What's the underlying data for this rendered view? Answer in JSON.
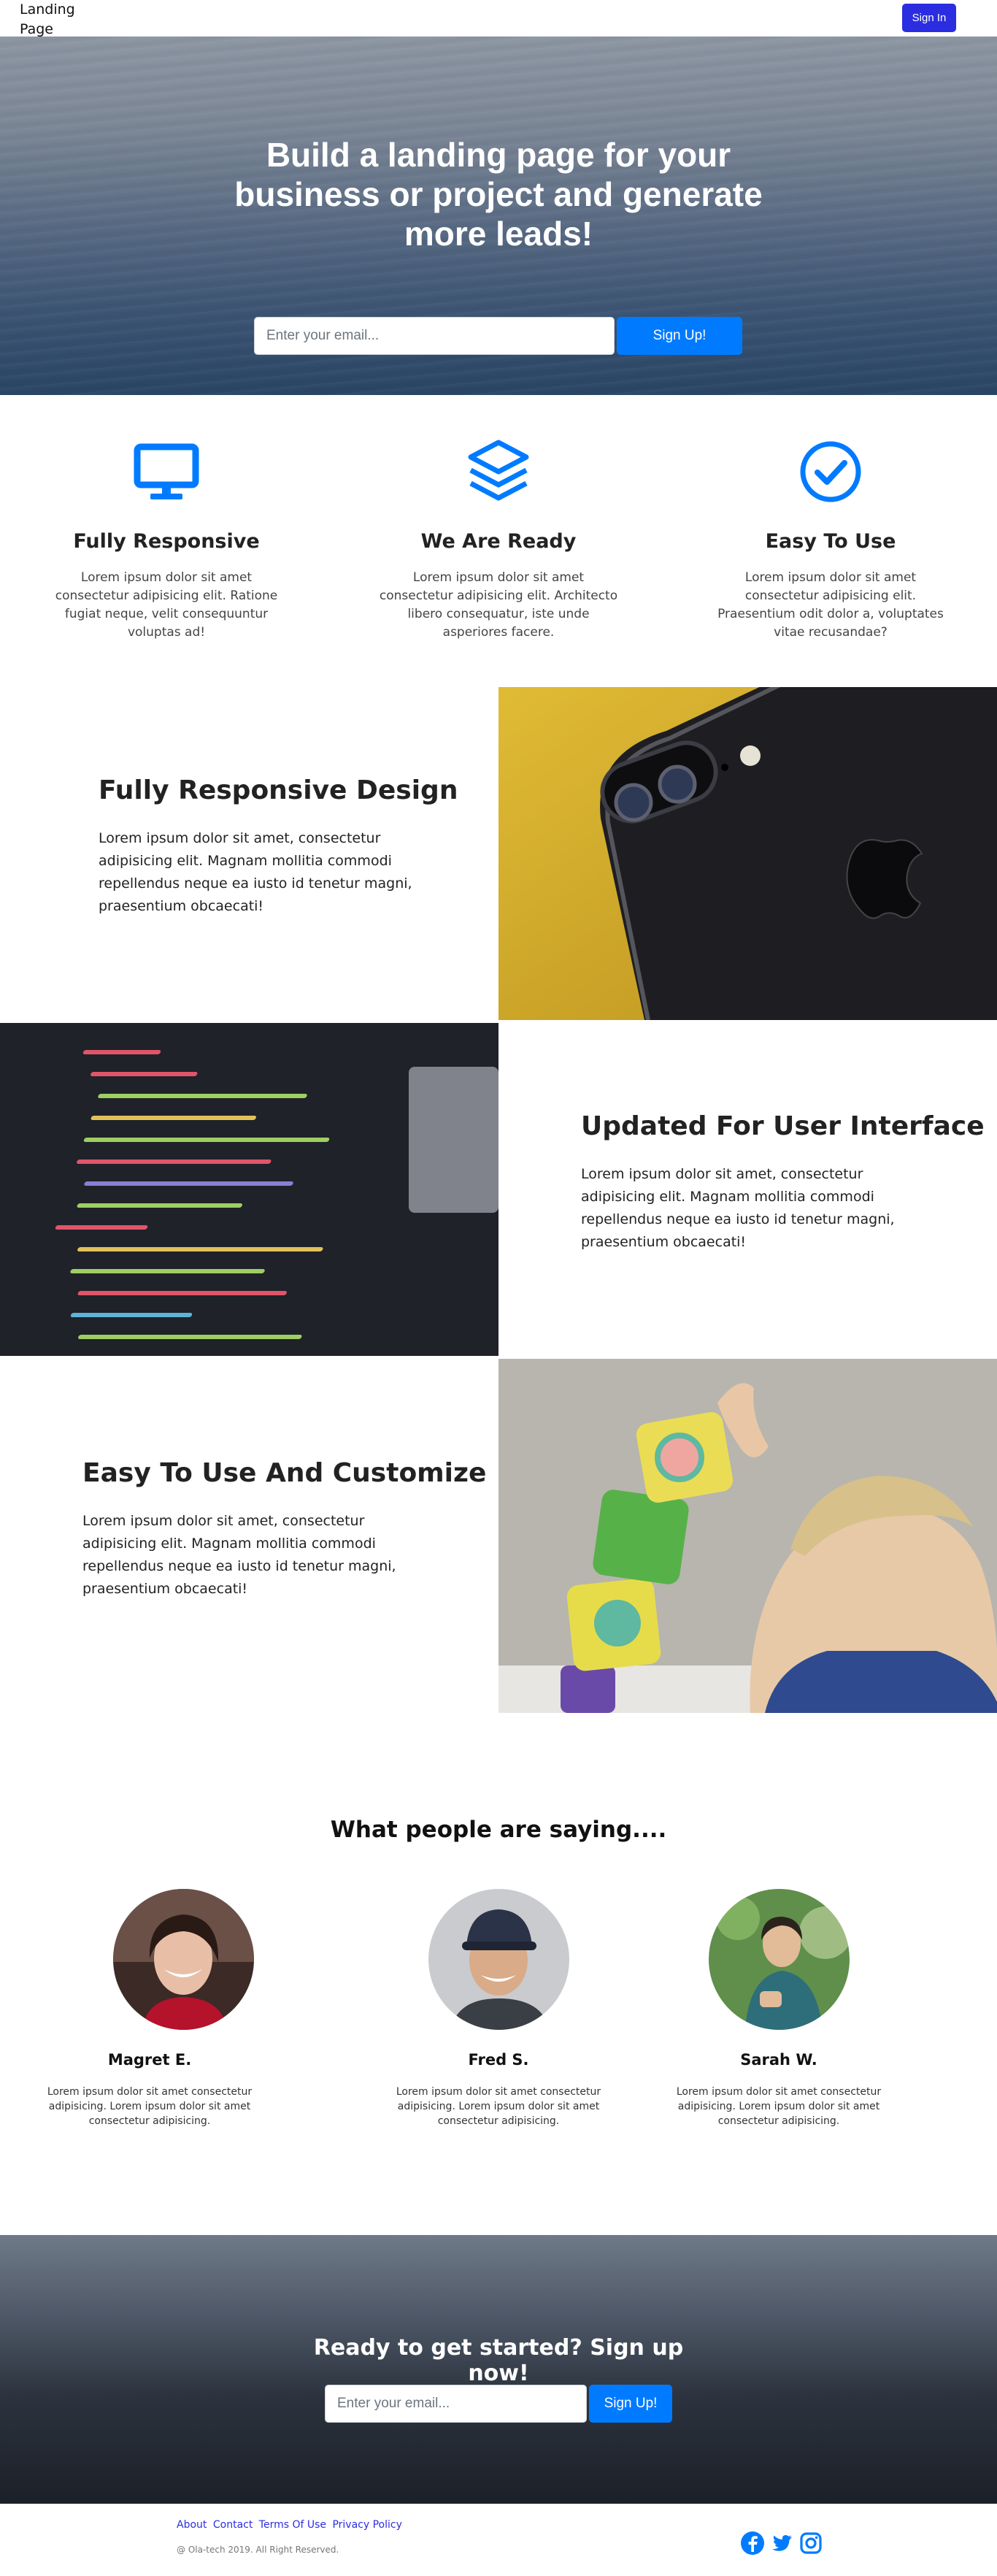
{
  "navbar": {
    "brand": "Landing Page",
    "signin_label": "Sign In"
  },
  "hero": {
    "title": "Build a landing page for your business or project and generate more leads!",
    "email_placeholder": "Enter your email...",
    "signup_label": "Sign Up!"
  },
  "features": [
    {
      "title": "Fully Responsive",
      "text": "Lorem ipsum dolor sit amet consectetur adipisicing elit. Ratione fugiat neque, velit consequuntur voluptas ad!",
      "icon": "monitor-icon"
    },
    {
      "title": "We Are Ready",
      "text": "Lorem ipsum dolor sit amet consectetur adipisicing elit. Architecto libero consequatur, iste unde asperiores facere.",
      "icon": "layers-icon"
    },
    {
      "title": "Easy To Use",
      "text": "Lorem ipsum dolor sit amet consectetur adipisicing elit. Praesentium odit dolor a, voluptates vitae recusandae?",
      "icon": "check-circle-icon"
    }
  ],
  "showcase": [
    {
      "title": "Fully Responsive Design",
      "text": "Lorem ipsum dolor sit amet, consectetur adipisicing elit. Magnam mollitia commodi repellendus neque ea iusto id tenetur magni, praesentium obcaecati!"
    },
    {
      "title": "Updated For User Interface",
      "text": "Lorem ipsum dolor sit amet, consectetur adipisicing elit. Magnam mollitia commodi repellendus neque ea iusto id tenetur magni, praesentium obcaecati!"
    },
    {
      "title": "Easy To Use And Customize",
      "text": "Lorem ipsum dolor sit amet, consectetur adipisicing elit. Magnam mollitia commodi repellendus neque ea iusto id tenetur magni, praesentium obcaecati!"
    }
  ],
  "testimonials": {
    "title": "What people are saying....",
    "people": [
      {
        "name": "Magret E.",
        "text": "Lorem ipsum dolor sit amet consectetur adipisicing. Lorem ipsum dolor sit amet consectetur adipisicing."
      },
      {
        "name": "Fred S.",
        "text": "Lorem ipsum dolor sit amet consectetur adipisicing. Lorem ipsum dolor sit amet consectetur adipisicing."
      },
      {
        "name": "Sarah W.",
        "text": "Lorem ipsum dolor sit amet consectetur adipisicing. Lorem ipsum dolor sit amet consectetur adipisicing."
      }
    ]
  },
  "cta": {
    "title": "Ready to get started? Sign up now!",
    "email_placeholder": "Enter your email...",
    "signup_label": "Sign Up!"
  },
  "footer": {
    "links": [
      "About",
      "Contact",
      "Terms Of Use",
      "Privacy Policy"
    ],
    "copyright": "@ Ola-tech 2019. All Right Reserved.",
    "social_icons": [
      "facebook-icon",
      "twitter-icon",
      "instagram-icon"
    ]
  },
  "colors": {
    "primary": "#007bff",
    "signin": "#2b2ee0"
  }
}
